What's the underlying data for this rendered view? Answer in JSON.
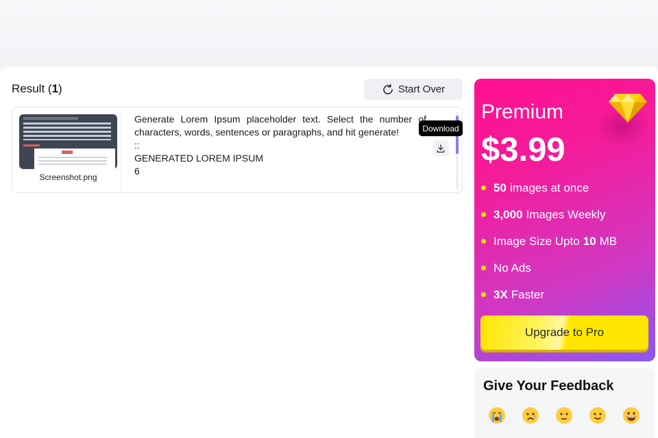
{
  "result": {
    "label": "Result (",
    "count": "1",
    "close": ")"
  },
  "start_over": {
    "label": "Start Over",
    "icon": "refresh-icon"
  },
  "items": [
    {
      "filename": "Screenshot.png",
      "text_para": "Generate Lorem Ipsum placeholder text. Select the number of characters, words, sentences or paragraphs, and hit generate!",
      "text_sep": "::",
      "text_heading": "GENERATED LOREM IPSUM",
      "text_count": "6"
    }
  ],
  "tooltip": {
    "label": "Download"
  },
  "download": {
    "icon": "download-icon"
  },
  "premium": {
    "title": "Premium",
    "price": "$3.99",
    "icon": "diamond-icon",
    "features": [
      {
        "bold": "50",
        "text": "images at once"
      },
      {
        "bold": "3,000",
        "text": "Images Weekly"
      },
      {
        "pre": "Image Size Upto",
        "bold": "10",
        "post": "MB"
      },
      {
        "text": "No Ads"
      },
      {
        "bold": "3X",
        "text": "Faster"
      }
    ],
    "upgrade_label": "Upgrade to Pro",
    "accent": "#ff0f8f",
    "accent_end": "#8b58f3",
    "button_color": "#ffe600"
  },
  "feedback": {
    "title": "Give Your Feedback",
    "emojis": [
      "crying-face-icon",
      "sad-face-icon",
      "neutral-face-icon",
      "smiling-face-icon",
      "grinning-face-icon"
    ]
  }
}
